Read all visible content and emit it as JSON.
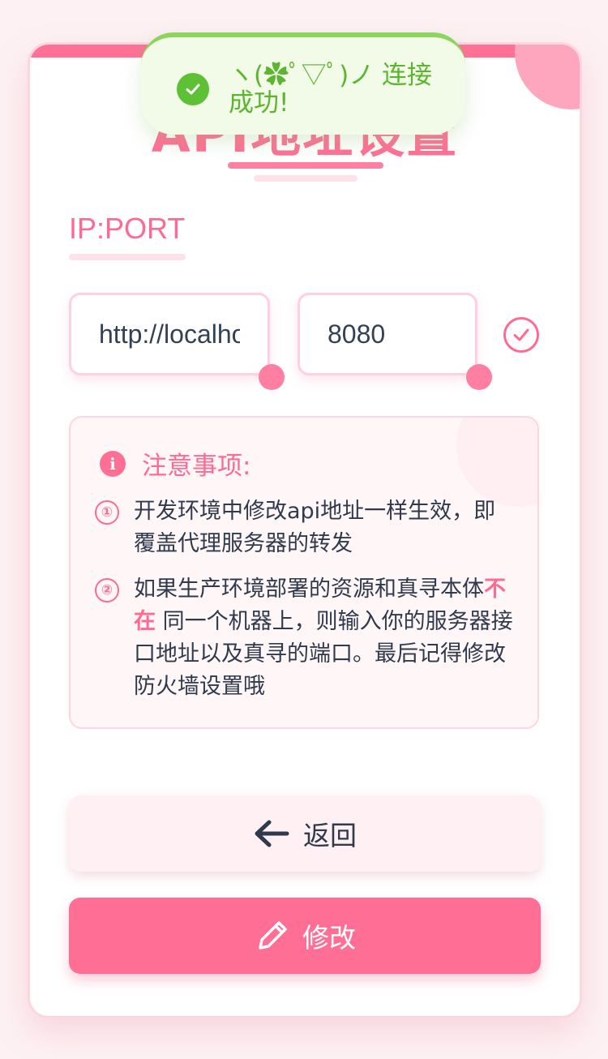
{
  "card": {
    "title": "API地址设置"
  },
  "form": {
    "label": "IP:PORT",
    "host_value": "http://localhost",
    "port_value": "8080"
  },
  "notice": {
    "title": "注意事项:",
    "item1_number": "①",
    "item1_text": "开发环境中修改api地址一样生效，即覆盖代理服务器的转发",
    "item2_number": "②",
    "item2_prefix": "如果生产环境部署的资源和真寻本体",
    "item2_emphasis": "不在",
    "item2_suffix": " 同一个机器上，则输入你的服务器接口地址以及真寻的端口。最后记得修改防火墙设置哦"
  },
  "buttons": {
    "back_label": "返回",
    "edit_label": "修改"
  },
  "toast": {
    "message": "ヽ(✿ﾟ▽ﾟ)ノ 连接成功!"
  },
  "colors": {
    "accent": "#ff6f95",
    "success": "#5ec035",
    "text": "#2f3a4d"
  }
}
